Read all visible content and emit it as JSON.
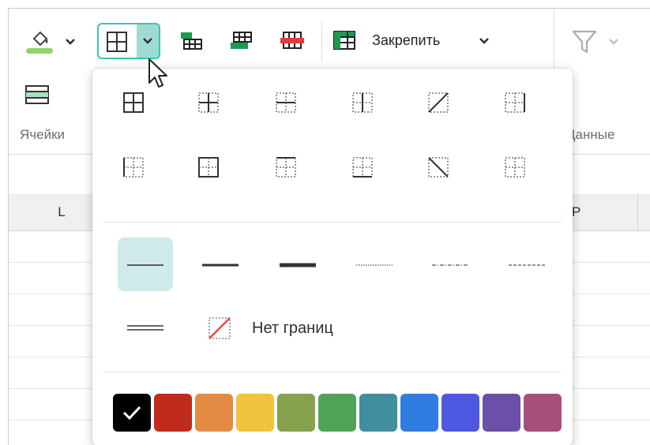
{
  "ribbon": {
    "group_cells_label": "Ячейки",
    "group_data_label": "Данные",
    "freeze_label": "Закрепить"
  },
  "icons": {
    "fill": "fill-color-icon",
    "borders": "borders-icon",
    "insert_table": "insert-table-icon",
    "insert_row": "insert-rows-icon",
    "delete_row": "delete-rows-icon",
    "freeze": "freeze-panes-icon",
    "filter": "filter-icon",
    "cell_format": "cell-format-icon"
  },
  "columns": {
    "left": "L",
    "right": "P"
  },
  "borders_menu": {
    "border_buttons": [
      "all-borders",
      "inner-borders",
      "inner-horizontal-borders",
      "inner-vertical-borders",
      "diagonal-up-border",
      "right-border",
      "left-border",
      "outer-borders",
      "top-border",
      "bottom-border",
      "diagonal-down-border",
      "no-outer-borders"
    ],
    "line_styles": [
      "thin",
      "medium",
      "thick",
      "dotted",
      "dash-dot",
      "dashed",
      "double"
    ],
    "selected_line_style": "thin",
    "no_border_label": "Нет границ",
    "colors": [
      "#000000",
      "#c02b1c",
      "#e48a43",
      "#f2c241",
      "#86a24c",
      "#52a35a",
      "#3f8f9f",
      "#2f7de1",
      "#4f58e0",
      "#6b4fa8",
      "#a84f7e"
    ],
    "selected_color": "#000000"
  },
  "accent": "#3ec3b4"
}
